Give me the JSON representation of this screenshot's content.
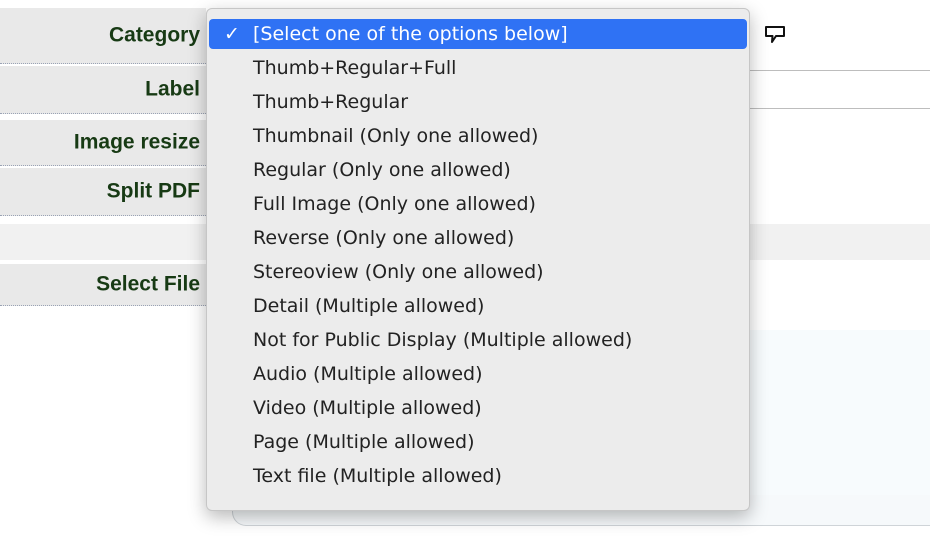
{
  "form": {
    "category_label": "Category",
    "label_label": "Label",
    "image_resize_label": "Image resize",
    "split_pdf_label": "Split PDF",
    "select_file_label": "Select File"
  },
  "dropdown": {
    "selected_index": 0,
    "options": [
      "[Select one of the options below]",
      "Thumb+Regular+Full",
      "Thumb+Regular",
      "Thumbnail (Only one allowed)",
      "Regular (Only one allowed)",
      "Full Image (Only one allowed)",
      "Reverse (Only one allowed)",
      "Stereoview (Only one allowed)",
      "Detail (Multiple allowed)",
      "Not for Public Display (Multiple allowed)",
      "Audio (Multiple allowed)",
      "Video (Multiple allowed)",
      "Page (Multiple allowed)",
      "Text file (Multiple allowed)"
    ]
  },
  "icons": {
    "help": "speech-bubble-icon"
  },
  "colors": {
    "label_text": "#173a14",
    "label_bg": "#e9e9e9",
    "selected_bg": "#2f72f4"
  }
}
